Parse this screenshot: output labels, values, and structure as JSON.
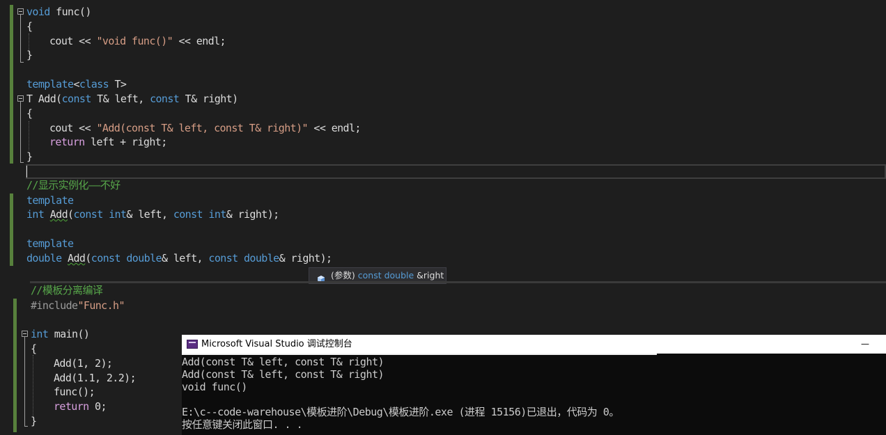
{
  "code": {
    "l1": {
      "kw": "void",
      "rest": " func()"
    },
    "l2": "{",
    "l3": {
      "a": "cout << ",
      "s": "\"void func()\"",
      "b": " << endl;"
    },
    "l4": "}",
    "l5": {
      "kw": "template",
      "a": "<",
      "kw2": "class",
      "b": " T>"
    },
    "l6": {
      "t": "T",
      "fn": " Add(",
      "k1": "const",
      "a": " T& left, ",
      "k2": "const",
      "b": " T& right)"
    },
    "l7": "{",
    "l8": {
      "a": "cout << ",
      "s": "\"Add(const T& left, const T& right)\"",
      "b": " << endl;"
    },
    "l9": {
      "kw": "return",
      "rest": " left + right;"
    },
    "l10": "}",
    "c1": "//显示实例化——不好",
    "l11": "template",
    "l12": {
      "k1": "int",
      "sp": " ",
      "fn": "Add",
      "a": "(",
      "k2": "const",
      "b": " ",
      "k3": "int",
      "c": "& left, ",
      "k4": "const",
      "d": " ",
      "k5": "int",
      "e": "& right);"
    },
    "l13": "template",
    "l14": {
      "k1": "double",
      "sp": " ",
      "fn": "Add",
      "a": "(",
      "k2": "const",
      "b": " ",
      "k3": "double",
      "c": "& left, ",
      "k4": "const",
      "d": " ",
      "k5": "double",
      "e": "& right);"
    },
    "c2": "//模板分离编译",
    "l15": {
      "kw": "#include",
      "s": "\"Func.h\""
    },
    "l16": {
      "kw": "int",
      "rest": " main()"
    },
    "l17": "{",
    "l18": "Add(1, 2);",
    "l19": "Add(1.1, 2.2);",
    "l20": "func();",
    "l21": {
      "kw": "return",
      "rest": " 0;"
    },
    "l22": "}"
  },
  "tooltip": {
    "prefix": "(参数)",
    "type": "const double",
    "name": "&right",
    "icon": "parameter-cube-icon"
  },
  "console": {
    "title": "Microsoft Visual Studio 调试控制台",
    "minimize": "—",
    "lines": [
      "Add(const T& left, const T& right)",
      "Add(const T& left, const T& right)",
      "void func()",
      "",
      "E:\\c--code-warehouse\\模板进阶\\Debug\\模板进阶.exe (进程 15156)已退出，代码为 0。",
      "按任意键关闭此窗口. . ."
    ]
  },
  "colors": {
    "background": "#1e1e1e",
    "keyword": "#569cd6",
    "control_keyword": "#d8a0df",
    "string": "#d69d85",
    "comment": "#57a64a",
    "change_bar": "#57803c"
  }
}
